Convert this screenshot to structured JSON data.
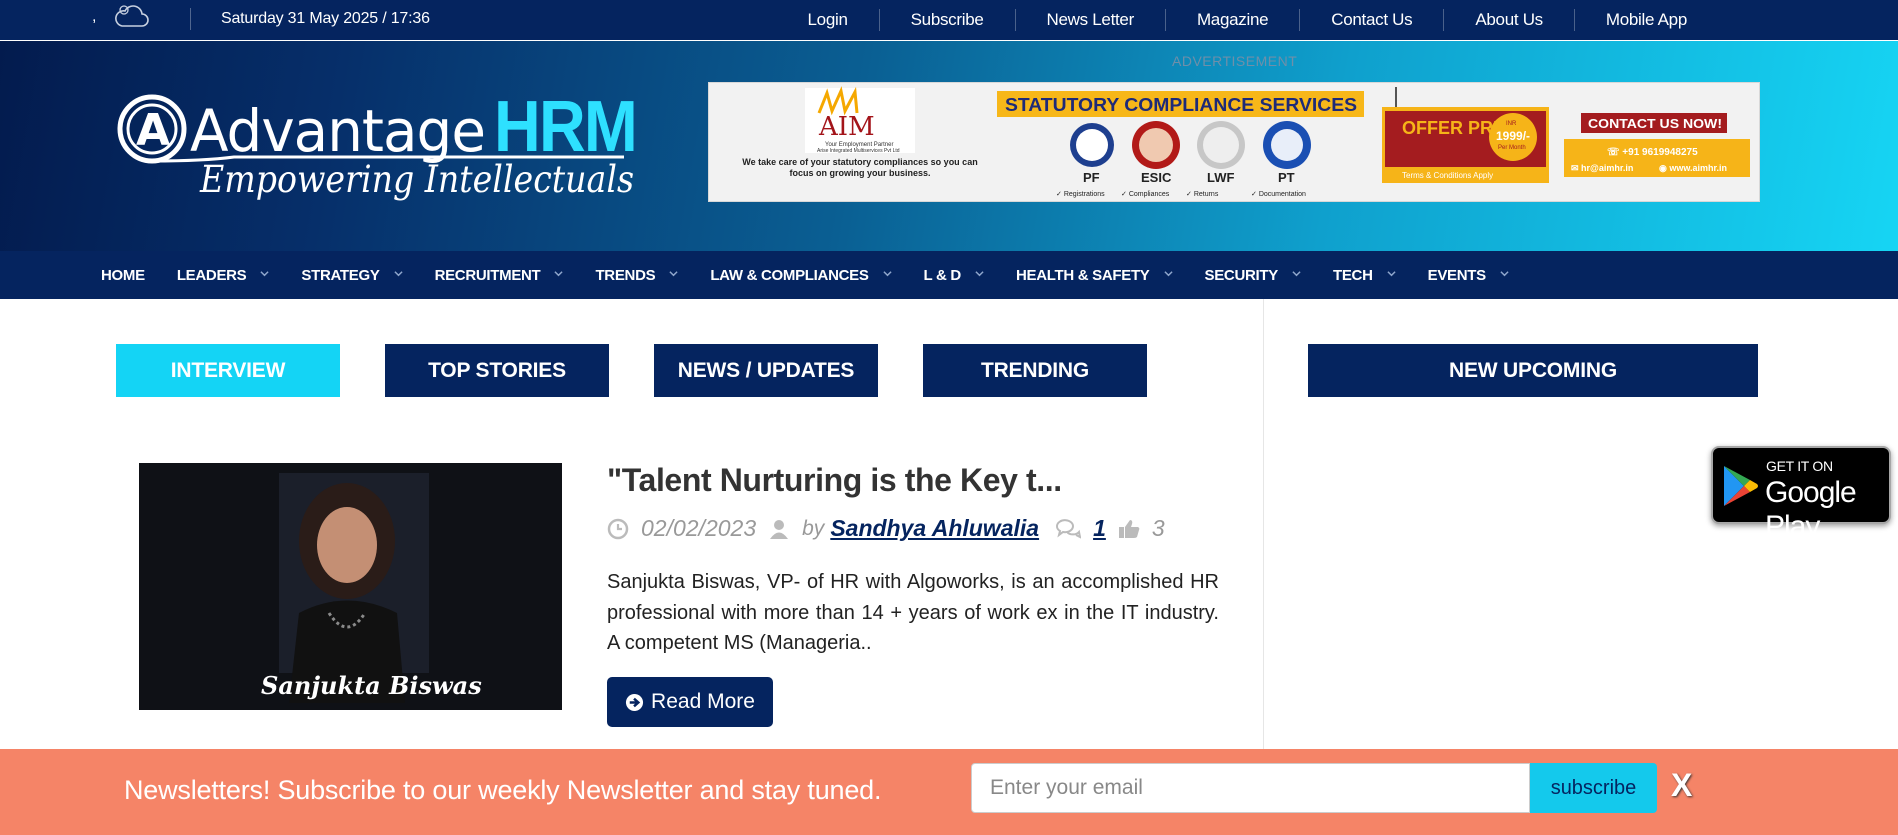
{
  "topbar": {
    "comma": ",",
    "weather_icon": "cloud-icon",
    "datetime": "Saturday 31 May 2025 / 17:36",
    "links": [
      "Login",
      "Subscribe",
      "News Letter",
      "Magazine",
      "Contact Us",
      "About Us",
      "Mobile App"
    ]
  },
  "header": {
    "logo_text": "Advantage",
    "logo_accent": "HRM",
    "logo_tagline": "Empowering Intellectuals",
    "ad_label": "ADVERTISEMENT",
    "ad": {
      "brand": "AIM",
      "brand_sub": "Your Employment Partner",
      "brand_sub2": "Arise Integrated Multiservices Pvt Ltd",
      "brand_blurb": "We take care of your statutory compliances so you can focus on growing your business.",
      "headline": "STATUTORY COMPLIANCE SERVICES",
      "services": [
        "PF",
        "ESIC",
        "LWF",
        "PT"
      ],
      "checks": [
        "Registrations",
        "Compliances",
        "Returns",
        "Documentation"
      ],
      "offer": "OFFER PRICE",
      "price": "1999/-",
      "price_top": "INR",
      "price_per": "Per Month",
      "terms": "Terms & Conditions Apply",
      "contact": "CONTACT US NOW!",
      "phone": "+91 9619948275",
      "email": "hr@aimhr.in",
      "web": "www.aimhr.in"
    }
  },
  "mainnav": [
    {
      "label": "HOME",
      "dropdown": false
    },
    {
      "label": "LEADERS",
      "dropdown": true
    },
    {
      "label": "STRATEGY",
      "dropdown": true
    },
    {
      "label": "RECRUITMENT",
      "dropdown": true
    },
    {
      "label": "TRENDS",
      "dropdown": true
    },
    {
      "label": "LAW & COMPLIANCES",
      "dropdown": true
    },
    {
      "label": "L & D",
      "dropdown": true
    },
    {
      "label": "HEALTH & SAFETY",
      "dropdown": true
    },
    {
      "label": "SECURITY",
      "dropdown": true
    },
    {
      "label": "TECH",
      "dropdown": true
    },
    {
      "label": "EVENTS",
      "dropdown": true
    }
  ],
  "tabs": [
    "INTERVIEW",
    "TOP STORIES",
    "NEWS / UPDATES",
    "TRENDING"
  ],
  "sidebar_tab": "NEW UPCOMING",
  "article": {
    "image_caption": "Sanjukta Biswas",
    "title": "\"Talent Nurturing is the Key t...",
    "date": "02/02/2023",
    "by": "by",
    "author": "Sandhya Ahluwalia",
    "comments": "1",
    "likes": "3",
    "excerpt": "Sanjukta Biswas, VP- of HR with Algoworks, is an accomplished HR professional with more than 14 + years of work ex in the IT industry. A competent MS (Manageria..",
    "read_more": "Read More"
  },
  "google_play": {
    "small": "GET IT ON",
    "big": "Google Play"
  },
  "newsletter": {
    "text": "Newsletters! Subscribe to our weekly Newsletter and stay tuned.",
    "placeholder": "Enter your email",
    "button": "subscribe",
    "close": "X"
  },
  "colors": {
    "navy": "#05245f",
    "cyan": "#14d4f5",
    "coral": "#f58467"
  }
}
